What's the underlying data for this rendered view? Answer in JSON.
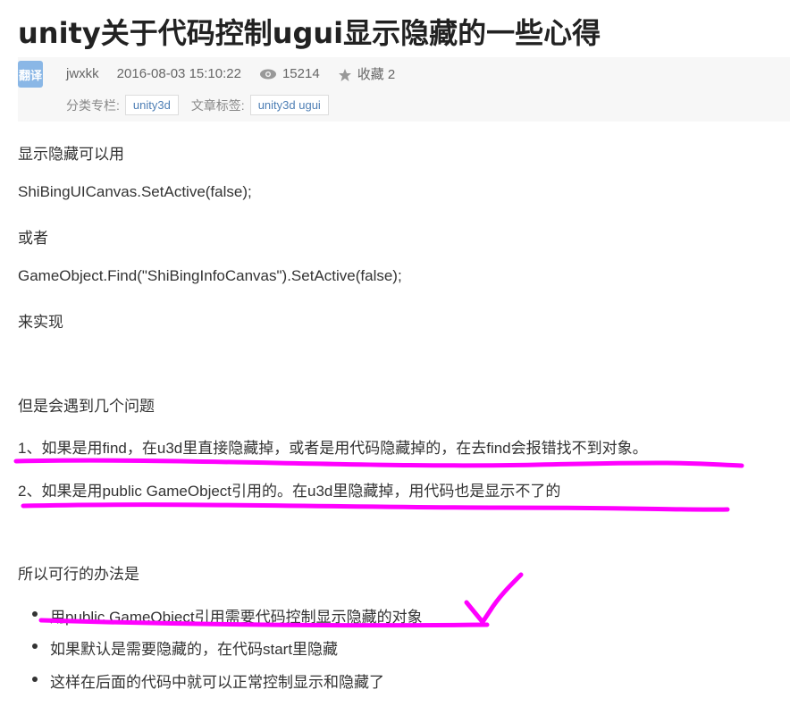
{
  "title": "unity关于代码控制ugui显示隐藏的一些心得",
  "meta": {
    "badge": "翻译",
    "author": "jwxkk",
    "datetime": "2016-08-03 15:10:22",
    "views": "15214",
    "favorites": "收藏 2",
    "category_label": "分类专栏:",
    "category": "unity3d",
    "tags_label": "文章标签:",
    "tag": "unity3d ugui"
  },
  "body": {
    "p1": "显示隐藏可以用",
    "p2": "ShiBingUICanvas.SetActive(false);",
    "p3": "或者",
    "p4": "GameObject.Find(\"ShiBingInfoCanvas\").SetActive(false);",
    "p5": "来实现",
    "p6": "但是会遇到几个问题",
    "p7": "1、如果是用find，在u3d里直接隐藏掉，或者是用代码隐藏掉的，在去find会报错找不到对象。",
    "p8": "2、如果是用public GameObject引用的。在u3d里隐藏掉，用代码也是显示不了的",
    "p9": "所以可行的办法是",
    "list": [
      "用public GameObject引用需要代码控制显示隐藏的对象",
      "如果默认是需要隐藏的，在代码start里隐藏",
      "这样在后面的代码中就可以正常控制显示和隐藏了"
    ]
  },
  "colors": {
    "annotation": "#ff00ff",
    "badge": "#8ab7e6"
  }
}
